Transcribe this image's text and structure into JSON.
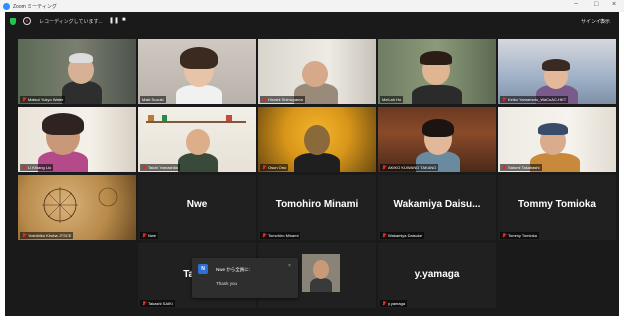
{
  "window": {
    "title": "Zoom ミーティング",
    "controls": [
      "−",
      "□",
      "×"
    ]
  },
  "toolbar": {
    "recording_text": "レコーディングしています...",
    "pause_icon": "pause-icon",
    "stop_icon": "stop-icon",
    "sign_in": "サインイン",
    "view": "表示"
  },
  "participants": [
    {
      "name": "Matsui Yukyo Water",
      "video": true,
      "active": true
    },
    {
      "name": "Maki Suzuki",
      "video": true
    },
    {
      "name": "Hiroshi Shimoyama",
      "video": true
    },
    {
      "name": "Ma'Lah Ho",
      "video": true
    },
    {
      "name": "Keiko Yamamoto_WaCuAC-HKT",
      "video": true
    },
    {
      "name": "Li Khiang Liu",
      "video": true
    },
    {
      "name": "Taichi Yamashita",
      "video": true
    },
    {
      "name": "Osun Ono",
      "video": true
    },
    {
      "name": "AKIKO KUWANO TAKANO",
      "video": true
    },
    {
      "name": "Satomi Takahashi",
      "video": true
    },
    {
      "name": "Yoshihiko Kiroha JTSCE",
      "video": true
    },
    {
      "name": "Nwe",
      "display": "Nwe",
      "video": false
    },
    {
      "name": "Tomohiro Minami",
      "display": "Tomohiro Minami",
      "video": false
    },
    {
      "name": "Wakamiya Daisuke",
      "display": "Wakamiya Daisu...",
      "video": false
    },
    {
      "name": "Tommy Tomioka",
      "display": "Tommy Tomioka",
      "video": false
    },
    {
      "name": "Takashi SAIKI",
      "display": "Takas",
      "video": false
    },
    {
      "name": "",
      "video": true
    },
    {
      "name": "y.yamaga",
      "display": "y.yamaga",
      "video": false
    }
  ],
  "chat": {
    "avatar": "N",
    "from": "Nwe から全員に:",
    "close": "×",
    "message": "Thank you"
  },
  "colors": {
    "background": "#1a1a1a",
    "active_speaker": "#b9e86a",
    "muted": "#e02828",
    "shield": "#23c552"
  }
}
